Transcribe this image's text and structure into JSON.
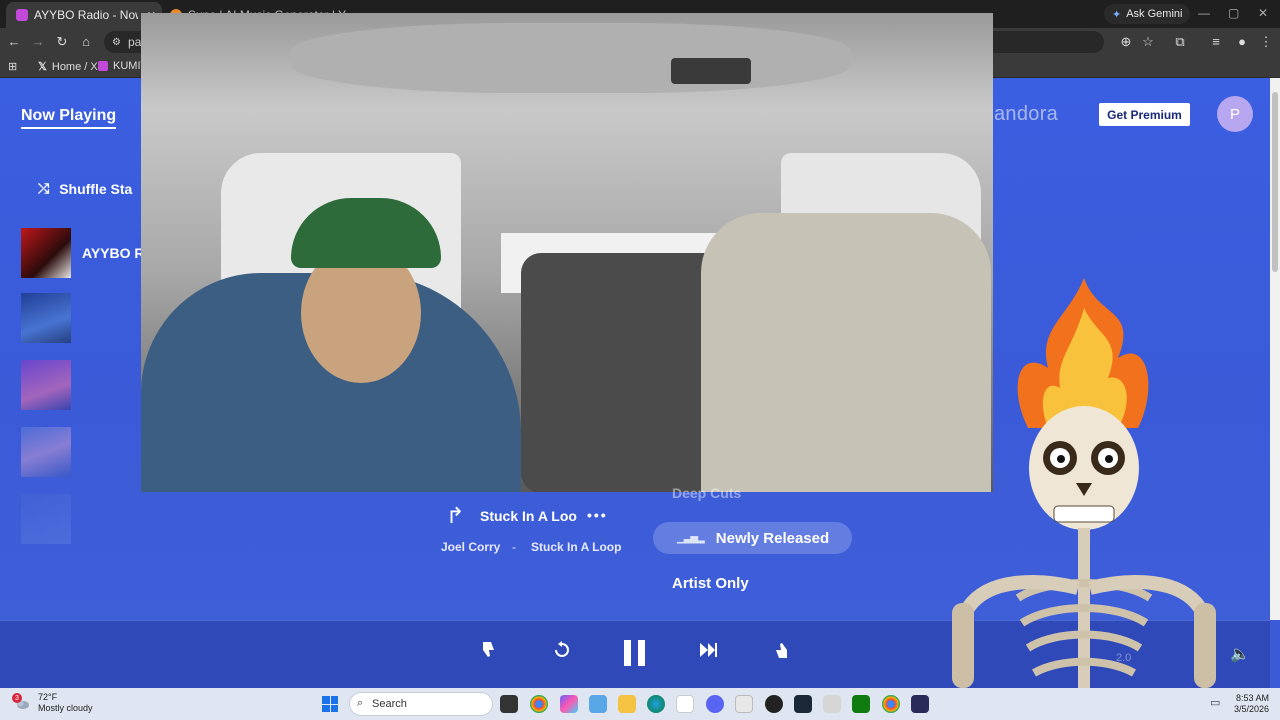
{
  "browser": {
    "active_tab_title": "AYYBO Radio - Now Playing",
    "second_tab_title": "Suno | AI Music Generator | Y...",
    "ask_gemini": "Ask Gemini",
    "url": "pa",
    "bookmarks": [
      {
        "label": "Home / X"
      },
      {
        "label": "KUMITE"
      }
    ]
  },
  "page": {
    "now_playing_tab": "Now Playing",
    "shuffle_label": "Shuffle Sta",
    "brand": "andora",
    "get_premium": "Get Premium",
    "avatar_initial": "P",
    "station_name": "AYYBO R"
  },
  "track": {
    "title": "Stuck In A Loo",
    "more": "•••",
    "artist": "Joel Corry",
    "separator": "-",
    "album": "Stuck In A Loop"
  },
  "modes": {
    "deep_cuts": "Deep Cuts",
    "newly_released": "Newly Released",
    "artist_only": "Artist Only"
  },
  "player": {
    "faded_label": "2.0"
  },
  "taskbar": {
    "notification_count": "3",
    "temperature": "72°F",
    "condition": "Mostly cloudy",
    "search_placeholder": "Search",
    "time": "8:53 AM",
    "date": "3/5/2026"
  },
  "colors": {
    "page_blue": "#3b5ad6",
    "player_bar": "#2f4ab8",
    "premium_text": "#1a2a7a",
    "avatar": "#b7a6f0"
  }
}
